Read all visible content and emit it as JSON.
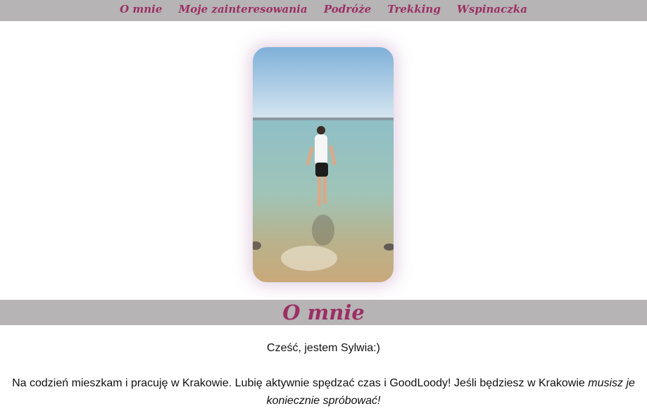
{
  "nav": {
    "items": [
      {
        "label": "O mnie"
      },
      {
        "label": "Moje zainteresowania"
      },
      {
        "label": "Podróże"
      },
      {
        "label": "Trekking"
      },
      {
        "label": "Wspinaczka"
      }
    ]
  },
  "section": {
    "title": "O mnie"
  },
  "content": {
    "greeting": "Cześć, jestem Sylwia:)",
    "bio_text": "Na codzień mieszkam i pracuję w Krakowie. Lubię aktywnie spędzać czas i GoodLoody! Jeśli będziesz w Krakowie ",
    "bio_emphasis": "musisz je koniecznie spróbować!"
  },
  "colors": {
    "accent": "#9b2f64",
    "bar": "#b6b4b5"
  }
}
